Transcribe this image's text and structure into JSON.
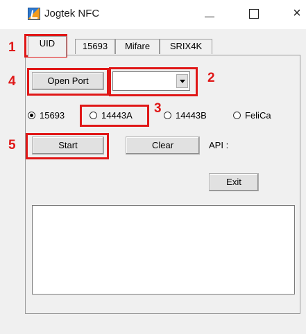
{
  "window": {
    "title": "Jogtek NFC",
    "controls": {
      "minimize": "",
      "maximize": "",
      "close": "×"
    }
  },
  "tabs": [
    "UID",
    "15693",
    "Mifare",
    "SRIX4K"
  ],
  "buttons": {
    "open_port": "Open Port",
    "start": "Start",
    "clear": "Clear",
    "exit": "Exit"
  },
  "port_select": {
    "value": ""
  },
  "protocol_radios": [
    {
      "label": "15693",
      "selected": true
    },
    {
      "label": "14443A",
      "selected": false
    },
    {
      "label": "14443B",
      "selected": false
    },
    {
      "label": "FeliCa",
      "selected": false
    }
  ],
  "api_label": "API :",
  "output_text": "",
  "annotations": [
    "1",
    "2",
    "3",
    "4",
    "5"
  ],
  "colors": {
    "annotation": "#e01717",
    "window_bg": "#f0f0f0",
    "button_bg": "#e1e1e1"
  }
}
